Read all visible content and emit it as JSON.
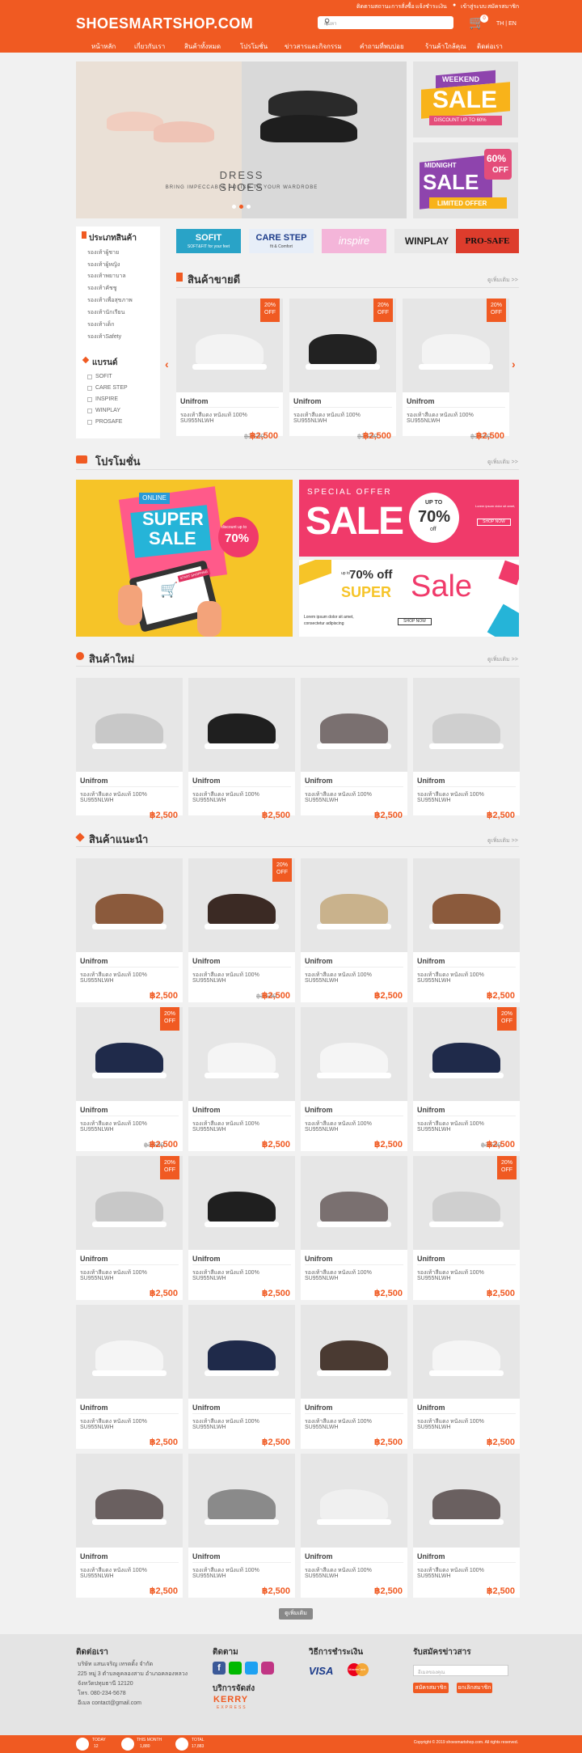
{
  "header": {
    "logo": "SHOESMARTSHOP.COM",
    "check_order": "ติดตามสถานะการสั่งซื้อ",
    "payment_notify": "แจ้งชำระเงิน",
    "login": "เข้าสู่ระบบ",
    "register": "สมัครสมาชิก",
    "search_placeholder": "ค้นหา",
    "cart_count": "0",
    "lang_th": "TH",
    "lang_en": "EN"
  },
  "nav": [
    "หน้าหลัก",
    "เกี่ยวกับเรา",
    "สินค้าทั้งหมด",
    "โปรโมชั่น",
    "ข่าวสารและกิจกรรม",
    "คำถามที่พบบ่อย",
    "ร้านค้าใกล้คุณ",
    "ติดต่อเรา"
  ],
  "slider": {
    "headline": "DRESS SHOES",
    "tagline": "BRING IMPECCABLE POLISH TO YOUR WARDROBE"
  },
  "side_banners": [
    {
      "l1": "WEEKEND",
      "l2": "SALE",
      "l3": "DISCOUNT UP TO 60%"
    },
    {
      "l1": "MIDNIGHT",
      "l2": "SALE",
      "l3": "LIMITED OFFER",
      "pct": "60%",
      "off": "OFF"
    }
  ],
  "categories": {
    "title": "ประเภทสินค้า",
    "items": [
      "รองเท้าผู้ชาย",
      "รองเท้าผู้หญิง",
      "รองเท้าพยาบาล",
      "รองเท้าคัชชู",
      "รองเท้าเพื่อสุขภาพ",
      "รองเท้านักเรียน",
      "รองเท้าเด็ก",
      "รองเท้าSafety"
    ]
  },
  "brands": {
    "title": "แบรนด์",
    "items": [
      "SOFIT",
      "CARE STEP",
      "INSPIRE",
      "WINPLAY",
      "PROSAFE"
    ]
  },
  "brand_logos": {
    "sofit": "SOFIT",
    "sofit_sub": "SOFT&FIT for your feet",
    "carestep": "CARE STEP",
    "carestep_sub": "fit & Comfort",
    "inspire": "inspire",
    "winplay": "WINPLAY",
    "prosafe": "PRO-SAFE"
  },
  "best_seller": {
    "title": "สินค้าขายดี",
    "more": "ดูเพิ่มเติม >>"
  },
  "promotions": {
    "title": "โปรโมชั่น",
    "more": "ดูเพิ่มเติม >>",
    "b1_online": "ONLINE",
    "b1_super": "SUPER",
    "b1_sale": "SALE",
    "b1_disc": "discount up to",
    "b1_pct": "70%",
    "b1_cart": "START SHOPPING",
    "b2_special": "SPECIAL OFFER",
    "b2_sale": "SALE",
    "b2_upto": "UP TO",
    "b2_pct": "70%",
    "b2_off": "off",
    "b2_shop": "SHOP NOW",
    "b2_lorem": "Lorem ipsum dolor sit amet,",
    "b3_upto": "up to",
    "b3_pct": "70% off",
    "b3_super": "SUPER",
    "b3_sale": "Sale",
    "b3_lorem1": "Lorem ipsum dolor sit amet,",
    "b3_lorem2": "consectetur adipiscing",
    "b3_shop": "SHOP NOW"
  },
  "new_products": {
    "title": "สินค้าใหม่",
    "more": "ดูเพิ่มเติม >>"
  },
  "recommended": {
    "title": "สินค้าแนะนำ",
    "more": "ดูเพิ่มเติม >>"
  },
  "product": {
    "brand": "Unifrom",
    "desc": "รองเท้าสีแดง หนังแท้ 100%",
    "sku": "SU955NLWH",
    "price": "฿2,500",
    "old_price": "฿3,500",
    "badge_pct": "20%",
    "badge_off": "OFF"
  },
  "load_more": "ดูเพิ่มเติม",
  "footer": {
    "contact_title": "ติดต่อเรา",
    "company": "บริษัท แสนเจริญ เทรดดิ้ง จำกัด",
    "addr1": "225 หมู่ 3 ตำบลคูคลองสาม อำเภอคลองหลวง",
    "addr2": "จังหวัดปทุมธานี 12120",
    "tel": "โทร. 080-234-5678",
    "email": "อีเมล contact@gmail.com",
    "follow_title": "ติดตาม",
    "pay_title": "วิธีการชำระเงิน",
    "visa": "VISA",
    "mastercard": "MasterCard",
    "ship_title": "บริการจัดส่ง",
    "kerry": "KERRY",
    "kerry_sub": "EXPRESS",
    "news_title": "รับสมัครข่าวสาร",
    "email_placeholder": "อีเมลของคุณ",
    "subscribe": "สมัครสมาชิก",
    "unsubscribe": "ยกเลิกสมาชิก"
  },
  "bottom": {
    "today": "TODAY",
    "today_val": "12",
    "month": "THIS MONTH",
    "month_val": "1,880",
    "total": "TOTAL",
    "total_val": "17,883",
    "copyright": "Copyright © 2019 shoesmartshop.com. All rights reserved."
  },
  "colors": {
    "accent": "#f05a22"
  }
}
